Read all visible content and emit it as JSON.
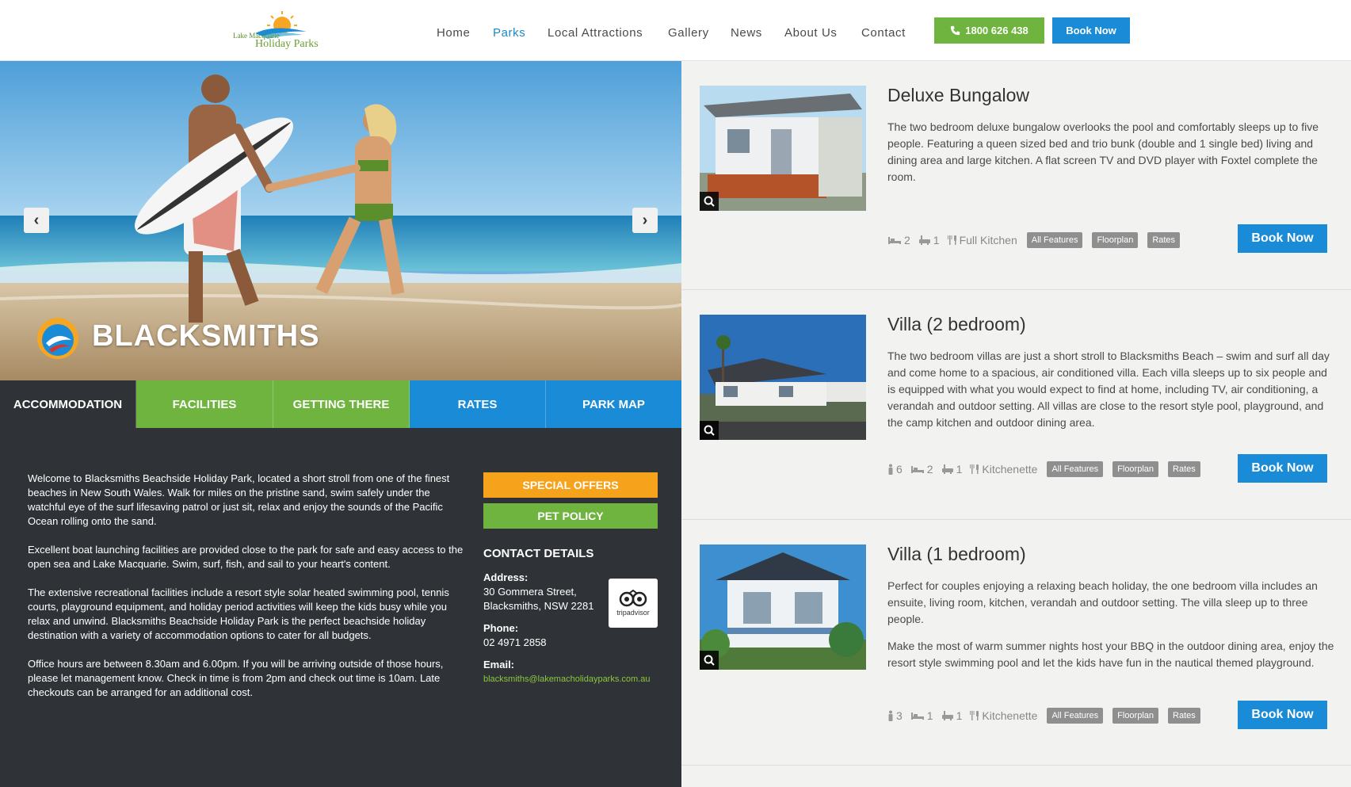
{
  "header": {
    "logo_top": "Lake Macquarie",
    "logo_bottom": "Holiday Parks",
    "nav": [
      {
        "label": "Home"
      },
      {
        "label": "Parks"
      },
      {
        "label": "Local Attractions"
      },
      {
        "label": "Gallery"
      },
      {
        "label": "News"
      },
      {
        "label": "About Us"
      },
      {
        "label": "Contact"
      }
    ],
    "active_nav": "Parks",
    "phone": "1800 626 438",
    "book_label": "Book Now"
  },
  "hero": {
    "title": "BLACKSMITHS",
    "prev_icon": "chevron-left-icon",
    "next_icon": "chevron-right-icon"
  },
  "tabs": [
    {
      "label": "ACCOMMODATION",
      "color": "#2f3337"
    },
    {
      "label": "FACILITIES",
      "color": "#6eb43f"
    },
    {
      "label": "GETTING THERE",
      "color": "#6eb43f"
    },
    {
      "label": "RATES",
      "color": "#1a8bd6"
    },
    {
      "label": "PARK MAP",
      "color": "#1a8bd6"
    }
  ],
  "intro": [
    "Welcome to Blacksmiths Beachside Holiday Park, located a short stroll from one of the finest beaches in New South Wales. Walk for miles on the pristine sand, swim safely under the watchful eye of the surf lifesaving patrol or just sit, relax and enjoy the sounds of the Pacific Ocean rolling onto the sand.",
    "Excellent boat launching facilities are provided close to the park for safe and easy access to the open sea and Lake Macquarie. Swim, surf, fish, and sail to your heart's content.",
    "The extensive recreational facilities include a resort style solar heated swimming pool, tennis courts, playground equipment, and holiday period activities will keep the kids busy while you relax and unwind. Blacksmiths Beachside Holiday Park is the perfect beachside holiday destination with a variety of accommodation options to cater for all budgets.",
    "Office hours are between 8.30am and 6.00pm. If you will be arriving outside of those hours, please let management know. Check in time is from 2pm and check out time is 10am. Late checkouts can be arranged for an additional cost."
  ],
  "side": {
    "special_offers": "SPECIAL OFFERS",
    "pet_policy": "PET POLICY",
    "contact_heading": "CONTACT DETAILS",
    "address_label": "Address:",
    "address_line1": "30 Gommera Street,",
    "address_line2": "Blacksmiths, NSW 2281",
    "phone_label": "Phone:",
    "phone": "02 4971 2858",
    "email_label": "Email:",
    "email": "blacksmiths@lakemacholidayparks.com.au",
    "tripadvisor": "tripadvisor"
  },
  "colors": {
    "green": "#6eb43f",
    "blue": "#1a8bd6",
    "orange": "#f7a21b",
    "dark": "#2f3337"
  },
  "listings": [
    {
      "title": "Deluxe Bungalow",
      "desc": [
        "The two bedroom deluxe bungalow overlooks the pool and comfortably sleeps up to five people. Featuring a queen sized bed and trio bunk (double and 1 single bed) living and dining area and large kitchen. A flat screen TV and DVD player with Foxtel complete the room."
      ],
      "guests": "",
      "beds": "2",
      "baths": "1",
      "kitchen": "Full Kitchen",
      "tags": [
        "All Features",
        "Floorplan",
        "Rates"
      ],
      "book": "Book Now"
    },
    {
      "title": "Villa (2 bedroom)",
      "desc": [
        "The two bedroom villas are just a short stroll to Blacksmiths Beach – swim and surf all day and come home to a spacious, air conditioned villa. Each villa sleeps up to six people and is equipped with what you would expect to find at home, including TV, air conditioning, a verandah and outdoor setting. All villas are close to the resort style pool, playground, and the camp kitchen and outdoor dining area."
      ],
      "guests": "6",
      "beds": "2",
      "baths": "1",
      "kitchen": "Kitchenette",
      "tags": [
        "All Features",
        "Floorplan",
        "Rates"
      ],
      "book": "Book Now"
    },
    {
      "title": "Villa (1 bedroom)",
      "desc": [
        "Perfect for couples enjoying a relaxing beach holiday, the one bedroom villa includes an ensuite, living room, kitchen, verandah and outdoor setting. The villa sleep up to three people.",
        "Make the most of warm summer nights host your BBQ in the outdoor dining area, enjoy the resort style swimming pool and let the kids have fun in the nautical themed playground."
      ],
      "guests": "3",
      "beds": "1",
      "baths": "1",
      "kitchen": "Kitchenette",
      "tags": [
        "All Features",
        "Floorplan",
        "Rates"
      ],
      "book": "Book Now"
    }
  ]
}
